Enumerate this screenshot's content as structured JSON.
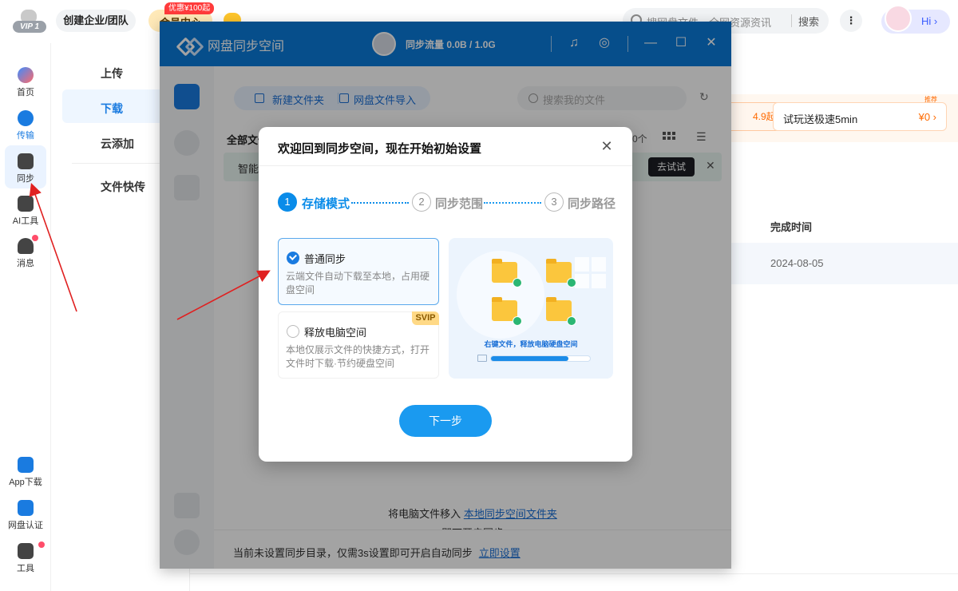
{
  "topbar": {
    "vip_tag": "VIP 1",
    "create_team": "创建企业/团队",
    "vip_center": "会员中心",
    "promo": "优惠¥100起",
    "search_placeholder": "搜网盘文件、全网资源资讯",
    "search_button": "搜索",
    "hi": "Hi ›"
  },
  "sidebar": {
    "items": [
      {
        "label": "首页",
        "icon": "cloud-home-icon"
      },
      {
        "label": "传输",
        "icon": "transfer-icon"
      },
      {
        "label": "同步",
        "icon": "sync-icon"
      },
      {
        "label": "AI工具",
        "icon": "ai-tool-icon"
      },
      {
        "label": "消息",
        "icon": "message-icon"
      }
    ],
    "bottom": [
      {
        "label": "App下载",
        "icon": "phone-icon"
      },
      {
        "label": "网盘认证",
        "icon": "verify-icon"
      },
      {
        "label": "工具",
        "icon": "tools-icon"
      }
    ]
  },
  "subnav": {
    "items": [
      "上传",
      "下载",
      "云添加",
      "文件快传"
    ]
  },
  "background": {
    "promo_price": "4.9起 ›",
    "promo2_title": "试玩送极速5min",
    "promo2_price": "¥0 ›",
    "recommend": "推荐",
    "col_header": "完成时间",
    "cell_date": "2024-08-05"
  },
  "sync_window": {
    "title": "网盘同步空间",
    "traffic": "同步流量 0.0B / 1.0G",
    "new_folder": "新建文件夹",
    "import": "网盘文件导入",
    "search_placeholder": "搜索我的文件",
    "all_files": "全部文件",
    "count": "0个",
    "smart_text": "智能",
    "try_btn": "去试试",
    "empty_line1_a": "将电脑文件移入",
    "empty_link": "本地同步空间文件夹",
    "empty_line2": "即可开启同步",
    "footer_text": "当前未设置同步目录，仅需3s设置即可开启自动同步",
    "footer_link": "立即设置"
  },
  "dialog": {
    "title": "欢迎回到同步空间，现在开始初始设置",
    "steps": [
      {
        "num": "1",
        "label": "存储模式"
      },
      {
        "num": "2",
        "label": "同步范围"
      },
      {
        "num": "3",
        "label": "同步路径"
      }
    ],
    "options": [
      {
        "title": "普通同步",
        "desc": "云端文件自动下载至本地，占用硬盘空间",
        "selected": true
      },
      {
        "title": "释放电脑空间",
        "desc": "本地仅展示文件的快捷方式，打开文件时下载·节约硬盘空间",
        "badge": "SVIP",
        "selected": false
      }
    ],
    "illustration_caption": "右键文件，释放电脑硬盘空间",
    "illustration_progress": 0.78,
    "next_button": "下一步"
  },
  "colors": {
    "accent": "#0a8ce9",
    "header_blue": "#0a7ad9",
    "annotation_red": "#e02020"
  }
}
